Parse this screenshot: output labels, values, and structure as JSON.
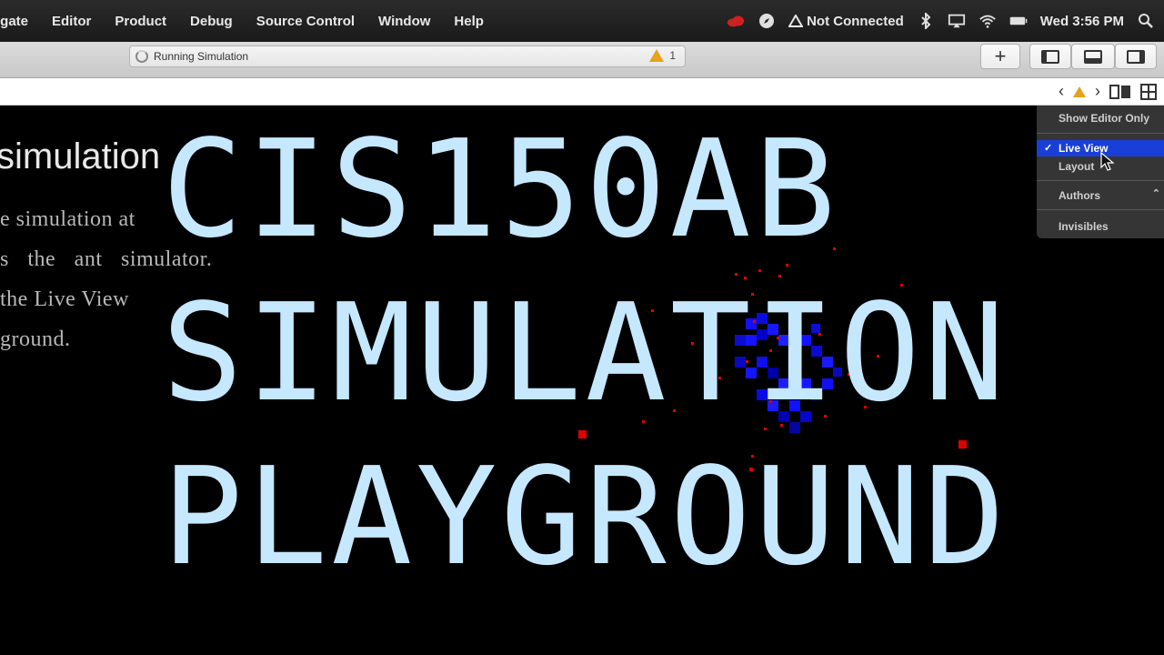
{
  "menubar": {
    "items": [
      "igate",
      "Editor",
      "Product",
      "Debug",
      "Source Control",
      "Window",
      "Help"
    ],
    "connection_status": "Not Connected",
    "clock": "Wed 3:56 PM"
  },
  "toolbar": {
    "activity_text": "Running Simulation",
    "warning_count": "1",
    "add_label": "+"
  },
  "document": {
    "heading": "simulation",
    "lines": [
      "e simulation at",
      "s the ant simulator.",
      "the Live View",
      "ground."
    ]
  },
  "editor_menu": {
    "show_editor_only": "Show Editor Only",
    "live_view": "Live View",
    "layout": "Layout",
    "authors": "Authors",
    "invisibles": "Invisibles"
  },
  "overlay": {
    "line1": "CIS150AB",
    "line2": "SIMULATION",
    "line3": "PLAYGROUND"
  },
  "colors": {
    "overlay_text": "#c5e8ff",
    "ant": "#e00000",
    "food": "#1010ff",
    "warning": "#e6a21e"
  }
}
